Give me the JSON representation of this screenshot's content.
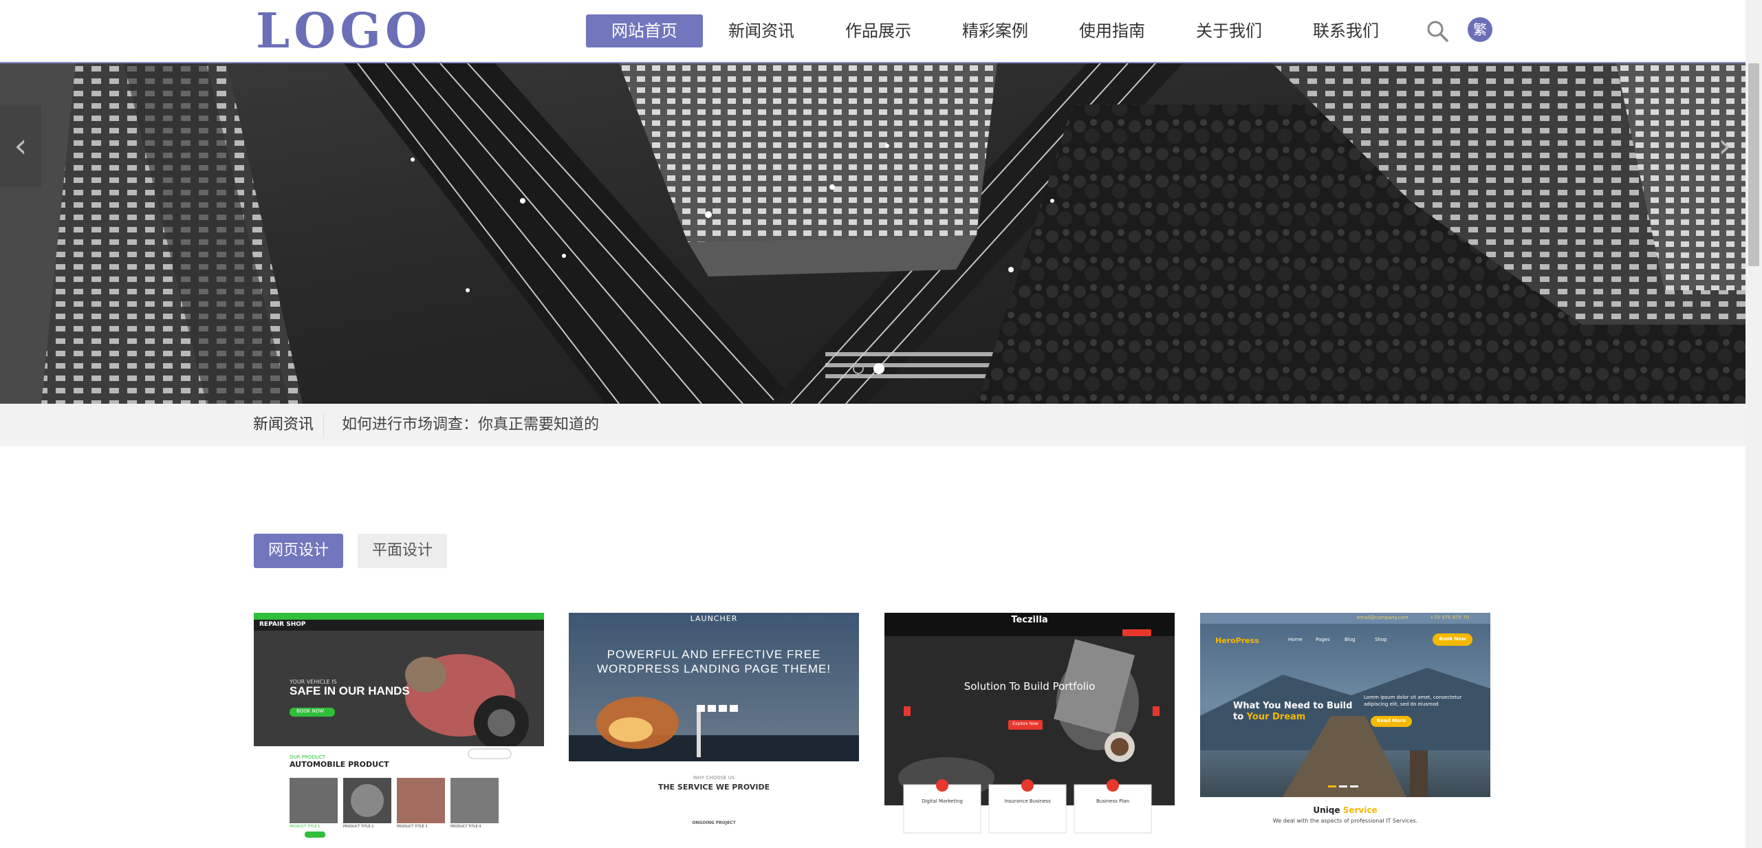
{
  "header": {
    "logo": "LOGO",
    "nav": [
      "网站首页",
      "新闻资讯",
      "作品展示",
      "精彩案例",
      "使用指南",
      "关于我们",
      "联系我们"
    ],
    "lang_badge": "繁"
  },
  "banner": {
    "prev_arrow": "‹",
    "next_arrow": "›",
    "active_slide": 2,
    "slide_count": 2
  },
  "news": {
    "label": "新闻资讯",
    "headline": "如何进行市场调查：你真正需要知道的"
  },
  "tabs": [
    "网页设计",
    "平面设计"
  ],
  "cards": [
    {
      "top_bar": "",
      "brand": "REPAIR SHOP",
      "hero_small": "YOUR VEHICLE IS",
      "hero_big": "SAFE IN OUR HANDS",
      "button": "BOOK NOW",
      "section_small": "OUR PRODUCT",
      "section_big": "AUTOMOBILE PRODUCT",
      "products": [
        "PRODUCT TITLE 1",
        "PRODUCT TITLE 2",
        "PRODUCT TITLE 3",
        "PRODUCT TITLE 4"
      ]
    },
    {
      "brand": "LAUNCHER",
      "hero_big": "POWERFUL AND EFFECTIVE FREE WORDPRESS LANDING PAGE THEME!",
      "section_small": "WHY CHOOSE US",
      "section_big": "THE SERVICE WE PROVIDE",
      "footer_small": "ONGOING PROJECT"
    },
    {
      "brand": "Teczilla",
      "hero_big": "Solution To Build Portfolio",
      "button": "Explore Now",
      "services": [
        "Digital Marketing",
        "Insurance Business",
        "Business Plan"
      ]
    },
    {
      "brand": "HeroPress",
      "email": "email@company.com",
      "phone": "+70 975 975 70",
      "menu": [
        "Home",
        "Pages",
        "Blog",
        "Shop"
      ],
      "button": "Book Now",
      "hero_line1": "What You Need to Build",
      "hero_line2a": "to ",
      "hero_line2b": "Your Dream",
      "hero_side": "Lorem ipsum dolor sit amet, consectetur adipiscing elit, sed do eiusmod",
      "side_button": "Read More",
      "section_a": "Uniqe ",
      "section_b": "Service",
      "section_sub": "We deal with the aspects of professional IT Services."
    }
  ],
  "colors": {
    "accent": "#7276bd",
    "green": "#2fbf3a",
    "red": "#e8372c",
    "yellow": "#f5b800"
  }
}
